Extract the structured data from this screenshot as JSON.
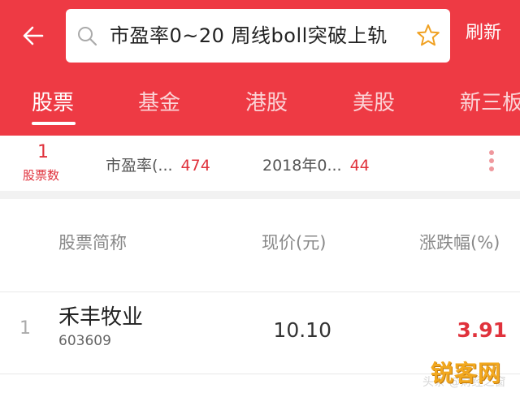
{
  "header": {
    "search_query": "市盈率0~20 周线boll突破上轨",
    "refresh_label": "刷新",
    "background_color": "#ee3a44"
  },
  "tabs": [
    {
      "label": "股票",
      "active": true
    },
    {
      "label": "基金",
      "active": false
    },
    {
      "label": "港股",
      "active": false
    },
    {
      "label": "美股",
      "active": false
    },
    {
      "label": "新三板",
      "active": false
    }
  ],
  "summary": {
    "stock_count": "1",
    "stock_count_label": "股票数",
    "conditions": [
      {
        "label": "市盈率(...",
        "count": "474"
      },
      {
        "label": "2018年0...",
        "count": "44"
      }
    ]
  },
  "table": {
    "columns": [
      "股票简称",
      "现价(元)",
      "涨跌幅(%)"
    ],
    "rows": [
      {
        "index": "1",
        "name": "禾丰牧业",
        "code": "603609",
        "price": "10.10",
        "change": "3.91"
      }
    ]
  },
  "watermark": {
    "logo_text": "锐客网",
    "subtext": "头条 @财经之窗"
  },
  "colors": {
    "accent": "#e0323c",
    "muted_text": "#888888"
  },
  "icons": [
    "back-arrow-icon",
    "search-icon",
    "star-icon",
    "more-vertical-icon"
  ]
}
